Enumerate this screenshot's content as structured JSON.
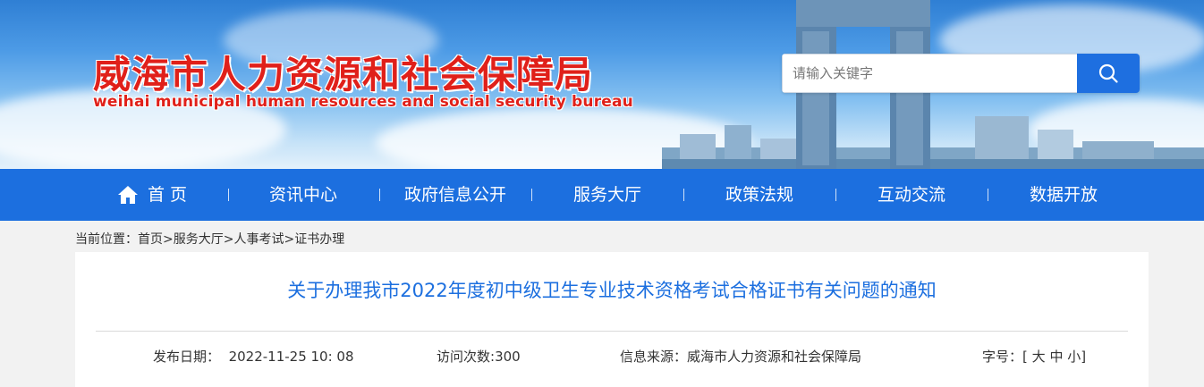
{
  "header": {
    "site_title": "威海市人力资源和社会保障局",
    "site_subtitle": "weihai municipal human resources and social security bureau",
    "search_placeholder": "请输入关键字",
    "colors": {
      "title_red": "#e0201a",
      "primary_blue": "#1c6fdf"
    }
  },
  "nav": {
    "items": [
      {
        "label": "首 页",
        "icon": "home-icon"
      },
      {
        "label": "资讯中心"
      },
      {
        "label": "政府信息公开"
      },
      {
        "label": "服务大厅"
      },
      {
        "label": "政策法规"
      },
      {
        "label": "互动交流"
      },
      {
        "label": "数据开放"
      }
    ]
  },
  "breadcrumb": {
    "prefix": "当前位置：",
    "items": [
      "首页",
      "服务大厅",
      "人事考试",
      "证书办理"
    ],
    "separator": ">"
  },
  "article": {
    "title": "关于办理我市2022年度初中级卫生专业技术资格考试合格证书有关问题的通知",
    "publish_label": "发布日期：",
    "publish_date": "2022-11-25 10: 08",
    "visits_label": "访问次数:",
    "visits": "300",
    "source_label": "信息来源：",
    "source": "威海市人力资源和社会保障局",
    "fontsize_label": "字号：",
    "fontsize_open": "[",
    "fontsize_large": "大",
    "fontsize_medium": "中",
    "fontsize_small": "小",
    "fontsize_close": "]"
  }
}
